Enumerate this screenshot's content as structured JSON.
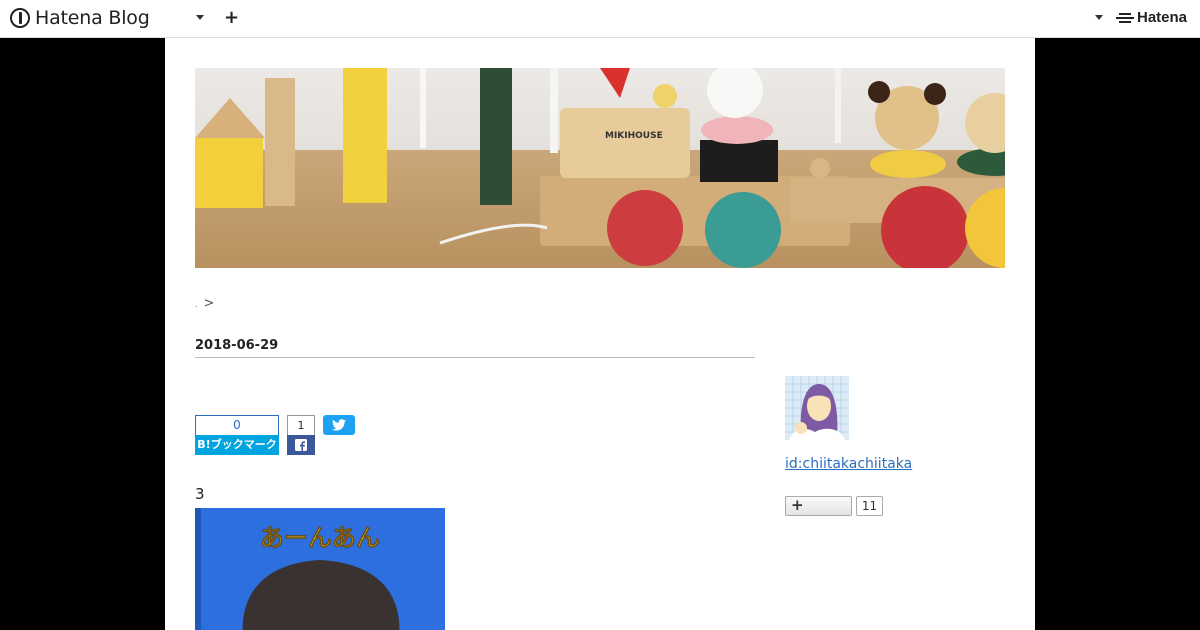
{
  "global_header": {
    "logo_text": "Hatena Blog",
    "brand_text": "Hatena",
    "add_icon": "plus-icon",
    "menu_icon": "caret-down-icon"
  },
  "breadcrumb": {
    "separator": ">"
  },
  "entry": {
    "date": "2018-06-29",
    "body_text": "3",
    "bookmark": {
      "count": "0",
      "label": "B!ブックマーク"
    },
    "facebook": {
      "count": "1",
      "icon": "facebook-icon"
    },
    "twitter": {
      "icon": "twitter-icon"
    },
    "book_title": "あーんあん"
  },
  "sidebar": {
    "profile_id": "id:chiitakachiitaka",
    "follow_count": "11",
    "follow_icon": "plus-icon"
  },
  "colors": {
    "hatena_bookmark": "#00a4de",
    "facebook": "#3b5998",
    "twitter": "#1da1f2",
    "link": "#2c6ebd",
    "book_cover": "#2e6fe0",
    "book_title": "#f2d22e"
  }
}
